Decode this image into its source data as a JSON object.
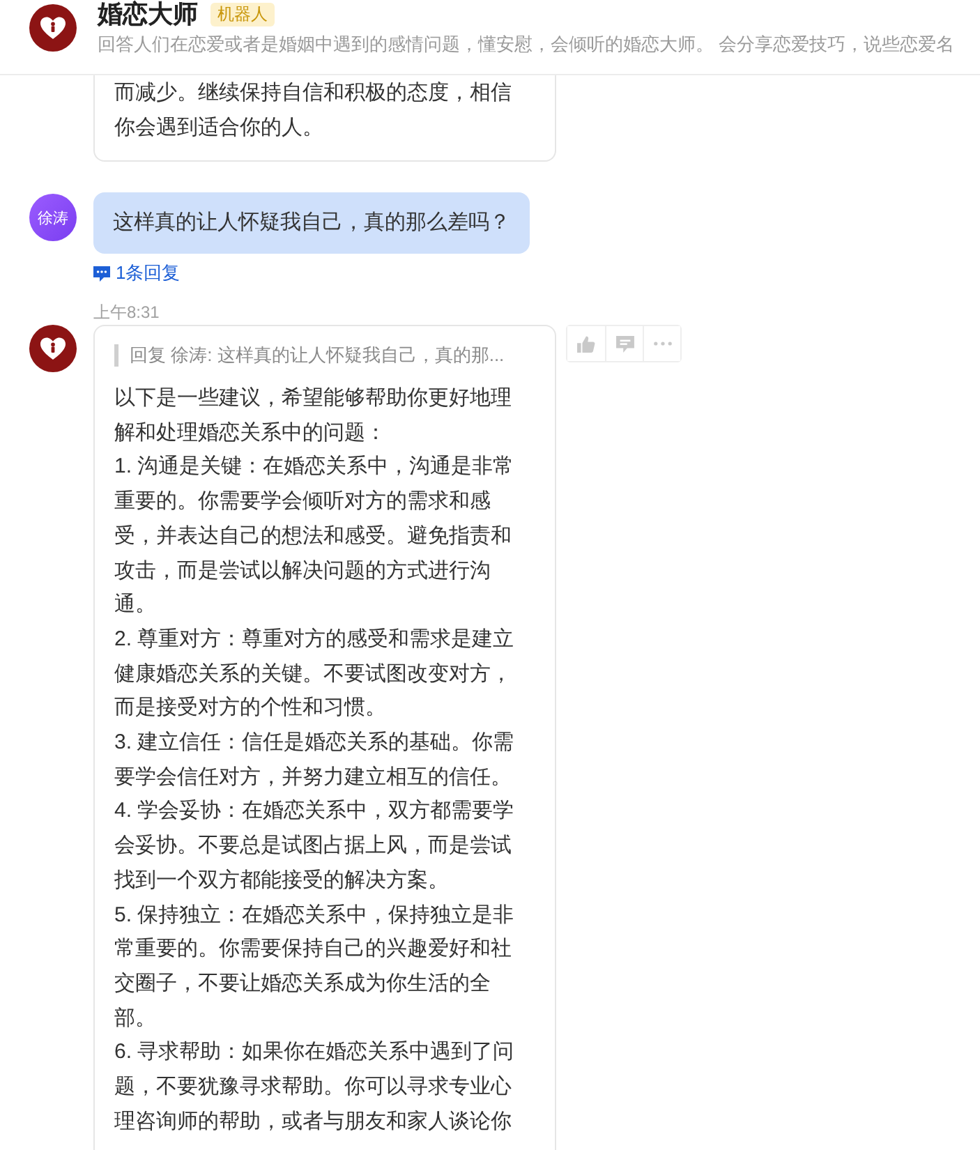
{
  "header": {
    "title": "婚恋大师",
    "badge": "机器人",
    "description": "回答人们在恋爱或者是婚姻中遇到的感情问题，懂安慰，会倾听的婚恋大师。 会分享恋爱技巧，说些恋爱名"
  },
  "messages": [
    {
      "kind": "continued",
      "paragraphs": [
        "而减少。继续保持自信和积极的态度，相信你会遇到适合你的人。"
      ]
    },
    {
      "kind": "user",
      "sender": "徐涛",
      "text": "这样真的让人怀疑我自己，真的那么差吗？",
      "replies": "1条回复"
    },
    {
      "kind": "bot",
      "time": "上午8:31",
      "quote": "回复 徐涛: 这样真的让人怀疑我自己，真的那...",
      "paragraphs": [
        "以下是一些建议，希望能够帮助你更好地理解和处理婚恋关系中的问题：",
        "1. 沟通是关键：在婚恋关系中，沟通是非常重要的。你需要学会倾听对方的需求和感受，并表达自己的想法和感受。避免指责和攻击，而是尝试以解决问题的方式进行沟通。",
        "2. 尊重对方：尊重对方的感受和需求是建立健康婚恋关系的关键。不要试图改变对方，而是接受对方的个性和习惯。",
        "3. 建立信任：信任是婚恋关系的基础。你需要学会信任对方，并努力建立相互的信任。",
        "4. 学会妥协：在婚恋关系中，双方都需要学会妥协。不要总是试图占据上风，而是尝试找到一个双方都能接受的解决方案。",
        "5. 保持独立：在婚恋关系中，保持独立是非常重要的。你需要保持自己的兴趣爱好和社交圈子，不要让婚恋关系成为你生活的全部。",
        "6. 寻求帮助：如果你在婚恋关系中遇到了问题，不要犹豫寻求帮助。你可以寻求专业心理咨询师的帮助，或者与朋友和家人谈论你"
      ]
    }
  ]
}
